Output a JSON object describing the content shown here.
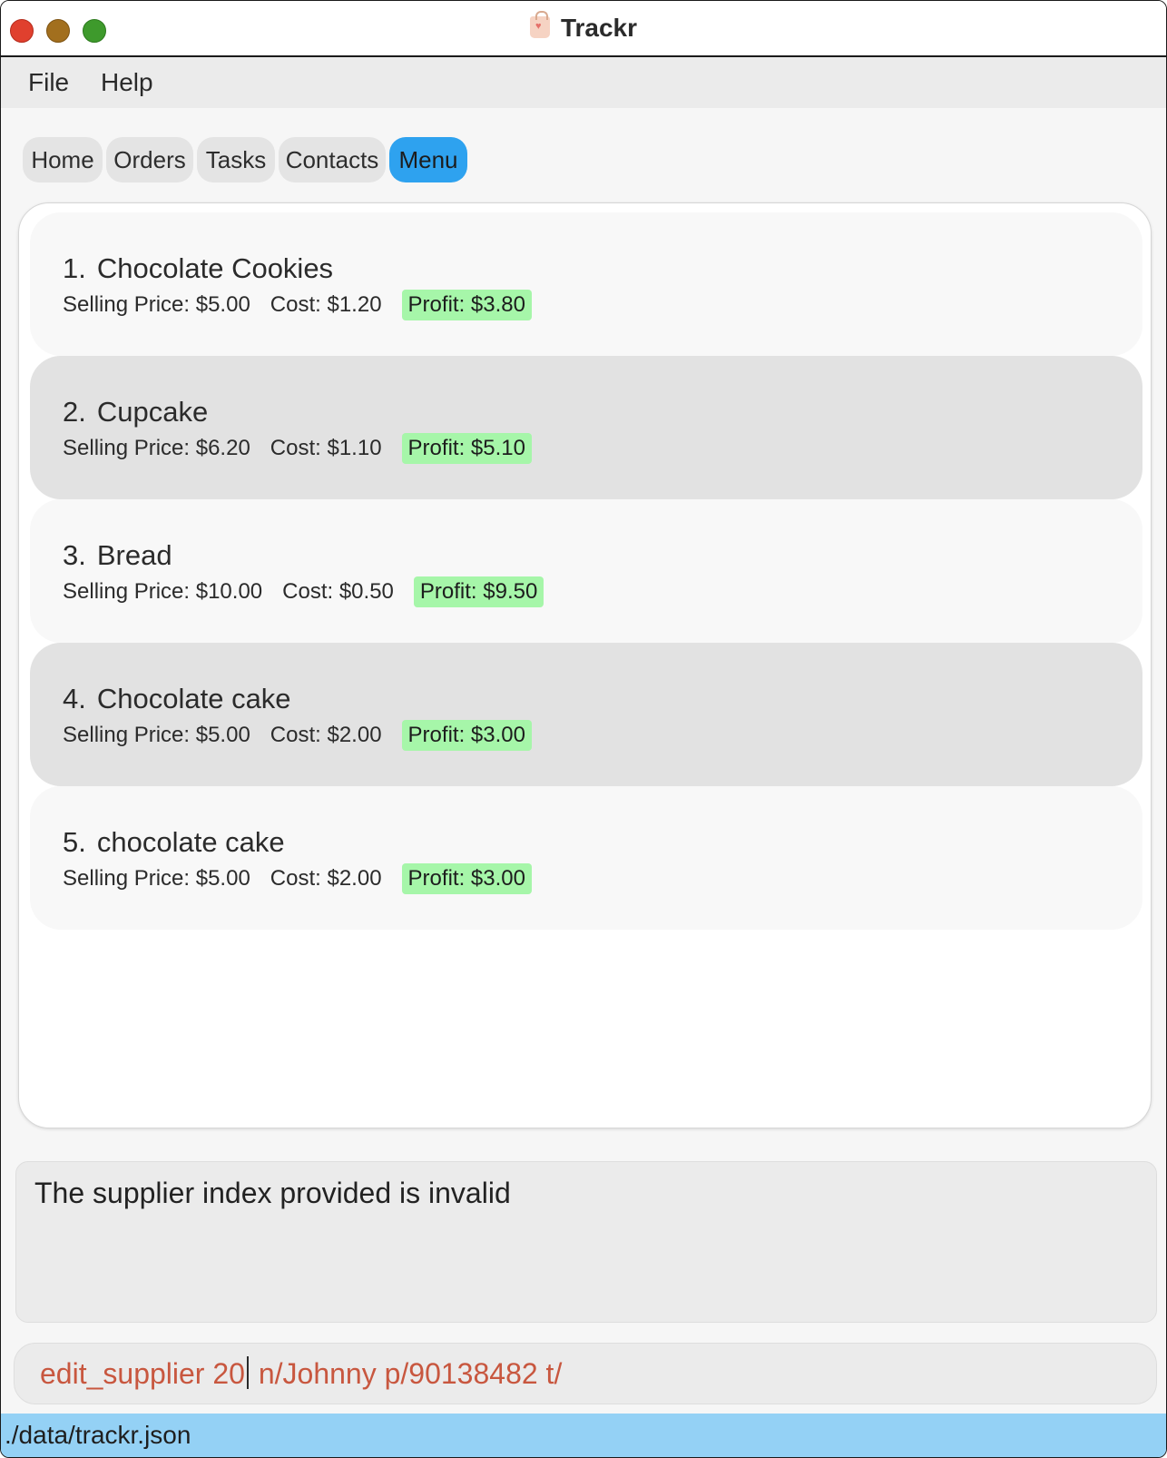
{
  "window": {
    "title": "Trackr",
    "app_icon": "shopping-bag-icon"
  },
  "menubar": {
    "file": "File",
    "help": "Help"
  },
  "tabs": [
    {
      "label": "Home",
      "active": false
    },
    {
      "label": "Orders",
      "active": false
    },
    {
      "label": "Tasks",
      "active": false
    },
    {
      "label": "Contacts",
      "active": false
    },
    {
      "label": "Menu",
      "active": true
    }
  ],
  "menu_items": [
    {
      "index": "1.",
      "name": "Chocolate Cookies",
      "selling_price": "Selling Price: $5.00",
      "cost": "Cost: $1.20",
      "profit": "Profit: $3.80"
    },
    {
      "index": "2.",
      "name": "Cupcake",
      "selling_price": "Selling Price: $6.20",
      "cost": "Cost: $1.10",
      "profit": "Profit: $5.10"
    },
    {
      "index": "3.",
      "name": "Bread",
      "selling_price": "Selling Price: $10.00",
      "cost": "Cost: $0.50",
      "profit": "Profit: $9.50"
    },
    {
      "index": "4.",
      "name": "Chocolate cake",
      "selling_price": "Selling Price: $5.00",
      "cost": "Cost: $2.00",
      "profit": "Profit: $3.00"
    },
    {
      "index": "5.",
      "name": "chocolate cake",
      "selling_price": "Selling Price: $5.00",
      "cost": "Cost: $2.00",
      "profit": "Profit: $3.00"
    }
  ],
  "result": {
    "message": "The supplier index provided is invalid"
  },
  "command": {
    "before_cursor": "edit_supplier 20",
    "after_cursor": " n/Johnny p/90138482 t/"
  },
  "status": {
    "file_path": "./data/trackr.json"
  },
  "colors": {
    "active_tab": "#2ea2ef",
    "profit_badge": "#a6f6a9",
    "command_text": "#c8573f",
    "status_bar": "#94d1f5"
  }
}
